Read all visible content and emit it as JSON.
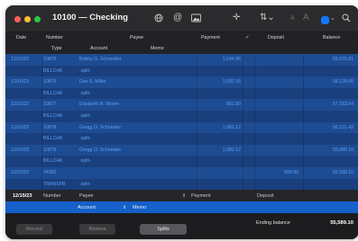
{
  "window": {
    "title": "10100 — Checking",
    "traffic_lights": {
      "close": "#ff5f57",
      "minimize": "#febc2e",
      "zoom": "#28c840"
    },
    "toolbar_icons": [
      "globe-icon",
      "at-sign-icon",
      "picture-icon",
      "crosshair-icon",
      "sort-icon",
      "text-smaller-icon",
      "text-larger-icon",
      "color-square-icon",
      "search-icon"
    ],
    "accent": "#1677ff"
  },
  "columns": {
    "line1": {
      "date": "Date",
      "number": "Number",
      "payee": "Payee",
      "payment": "Payment",
      "check": "✓",
      "deposit": "Deposit",
      "balance": "Balance"
    },
    "line2": {
      "type": "Type",
      "account": "Account",
      "memo": "Memo"
    }
  },
  "register": {
    "transactions": [
      {
        "date": "12/10/23",
        "number": "10876",
        "payee": "Bobby G. Schneider",
        "payment": "1,544.96",
        "deposit": "",
        "balance": "59,970.81",
        "type": "BILLCHK",
        "account": "-split-"
      },
      {
        "date": "12/10/23",
        "number": "10879",
        "payee": "Dan S. Miller",
        "payment": "1,092.15",
        "deposit": "",
        "balance": "58,128.66",
        "type": "BILLCHK",
        "account": "-split-"
      },
      {
        "date": "12/15/23",
        "number": "10877",
        "payee": "Elizabeth N. Moore",
        "payment": "882.80",
        "deposit": "",
        "balance": "57,183.54",
        "type": "BILLCHK",
        "account": "-split-"
      },
      {
        "date": "12/15/23",
        "number": "10878",
        "payee": "Gregg O. Schneider",
        "payment": "1,082.12",
        "deposit": "",
        "balance": "56,101.42",
        "type": "BILLCHK",
        "account": "-split-"
      },
      {
        "date": "12/15/23",
        "number": "10879",
        "payee": "Gregg O. Schneider",
        "payment": "1,082.12",
        "deposit": "",
        "balance": "55,089.10",
        "type": "BILLCHK",
        "account": "-split-"
      },
      {
        "date": "12/15/23",
        "number": "34382",
        "payee": "",
        "payment": "",
        "deposit": "500.00",
        "balance": "55,589.10",
        "type": "TRANSFR",
        "account": "-split-"
      }
    ]
  },
  "entry": {
    "date": "12/15/23",
    "number_placeholder": "Number",
    "payee_placeholder": "Payee",
    "payment_placeholder": "Payment",
    "deposit_placeholder": "Deposit",
    "account_placeholder": "Account",
    "memo_placeholder": "Memo"
  },
  "footer": {
    "record_label": "Record",
    "restore_label": "Restore",
    "splits_label": "Splits",
    "ending_balance_label": "Ending balance",
    "ending_balance_value": "55,589.10"
  }
}
